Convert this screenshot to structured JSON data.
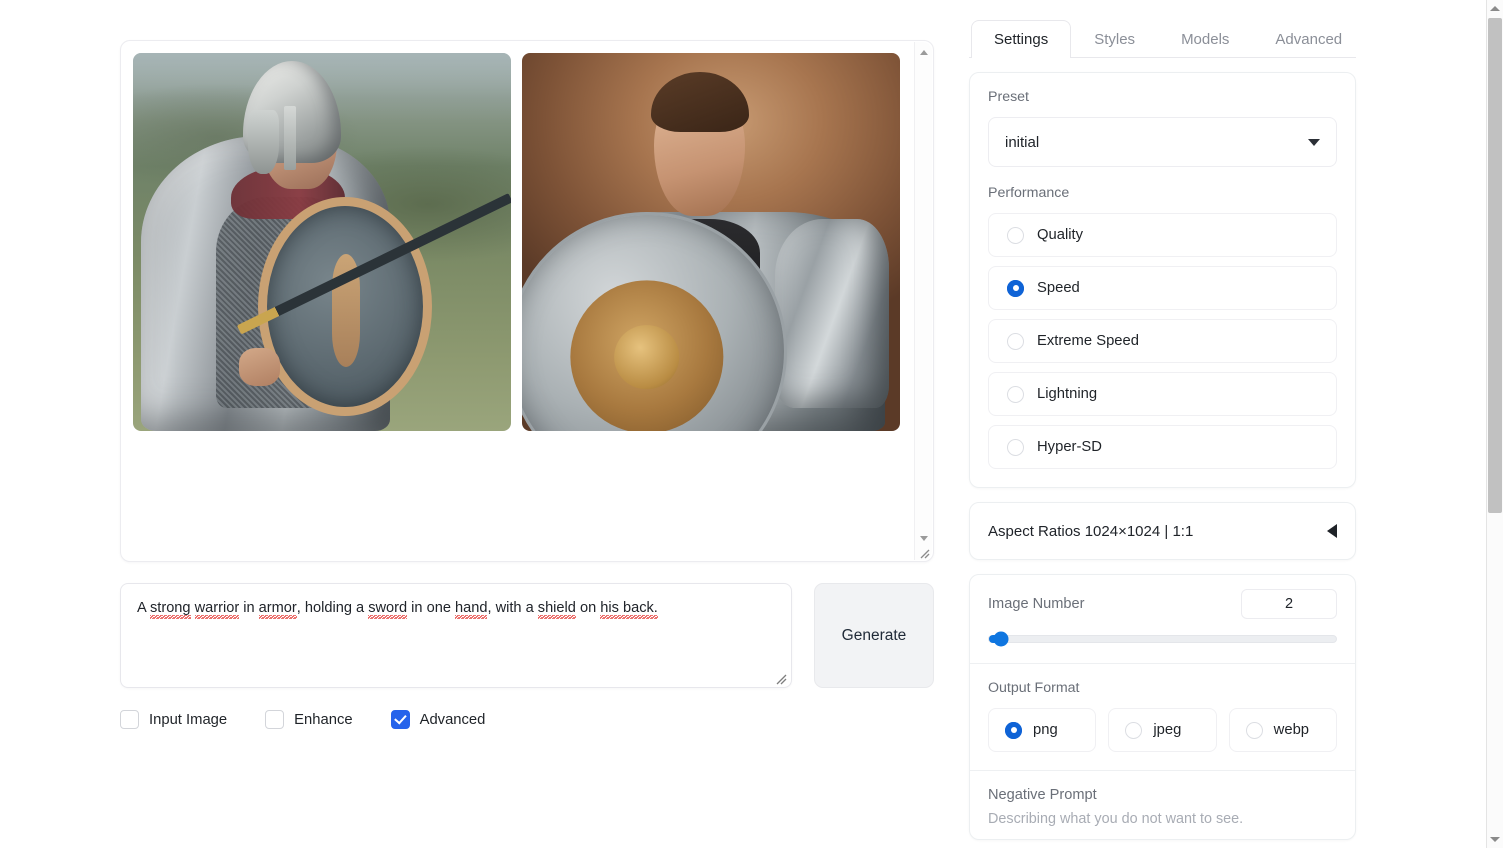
{
  "gallery": {
    "images": [
      {
        "alt": "Generated warrior in plate armor with shield and sword on green hills"
      },
      {
        "alt": "Generated warrior portrait in armor with round shield, brown backdrop"
      }
    ],
    "scroll_up_icon": "triangle-up-icon",
    "scroll_down_icon": "triangle-down-icon",
    "resize_icon": "resize-grip-icon"
  },
  "prompt": {
    "text_segments": [
      {
        "text": "A ",
        "misspelled": false
      },
      {
        "text": "strong",
        "misspelled": true
      },
      {
        "text": " ",
        "misspelled": false
      },
      {
        "text": "warrior",
        "misspelled": true
      },
      {
        "text": " in ",
        "misspelled": false
      },
      {
        "text": "armor",
        "misspelled": true
      },
      {
        "text": ", holding a ",
        "misspelled": false
      },
      {
        "text": "sword",
        "misspelled": true
      },
      {
        "text": " in one ",
        "misspelled": false
      },
      {
        "text": "hand",
        "misspelled": true
      },
      {
        "text": ", with a ",
        "misspelled": false
      },
      {
        "text": "shield",
        "misspelled": true
      },
      {
        "text": " on ",
        "misspelled": false
      },
      {
        "text": "his back.",
        "misspelled": true
      }
    ],
    "full_text": "A strong warrior in armor, holding a sword in one hand, with a shield on his back.",
    "resize_icon": "resize-grip-icon"
  },
  "generate_button": {
    "label": "Generate"
  },
  "checkboxes": [
    {
      "label": "Input Image",
      "checked": false
    },
    {
      "label": "Enhance",
      "checked": false
    },
    {
      "label": "Advanced",
      "checked": true
    }
  ],
  "footer": {
    "clipped_text": "................."
  },
  "settings": {
    "tabs": [
      {
        "label": "Settings",
        "active": true
      },
      {
        "label": "Styles",
        "active": false
      },
      {
        "label": "Models",
        "active": false
      },
      {
        "label": "Advanced",
        "active": false
      }
    ],
    "preset": {
      "label": "Preset",
      "value": "initial",
      "caret_icon": "chevron-down-icon"
    },
    "performance": {
      "label": "Performance",
      "selected": "Speed",
      "options": [
        {
          "label": "Quality",
          "selected": false
        },
        {
          "label": "Speed",
          "selected": true
        },
        {
          "label": "Extreme Speed",
          "selected": false
        },
        {
          "label": "Lightning",
          "selected": false
        },
        {
          "label": "Hyper-SD",
          "selected": false
        }
      ]
    },
    "aspect_ratios": {
      "label": "Aspect Ratios 1024×1024 | 1:1",
      "caret_icon": "caret-left-icon"
    },
    "image_number": {
      "label": "Image Number",
      "value": "2",
      "slider_percent": 4
    },
    "output_format": {
      "label": "Output Format",
      "selected": "png",
      "options": [
        {
          "label": "png",
          "selected": true
        },
        {
          "label": "jpeg",
          "selected": false
        },
        {
          "label": "webp",
          "selected": false
        }
      ]
    },
    "negative_prompt": {
      "label": "Negative Prompt",
      "placeholder": "Describing what you do not want to see."
    }
  },
  "colors": {
    "accent_blue": "#0f63d6",
    "checkbox_blue": "#2563eb",
    "slider_blue": "#0f76e0",
    "spellcheck_red": "#e53935"
  }
}
